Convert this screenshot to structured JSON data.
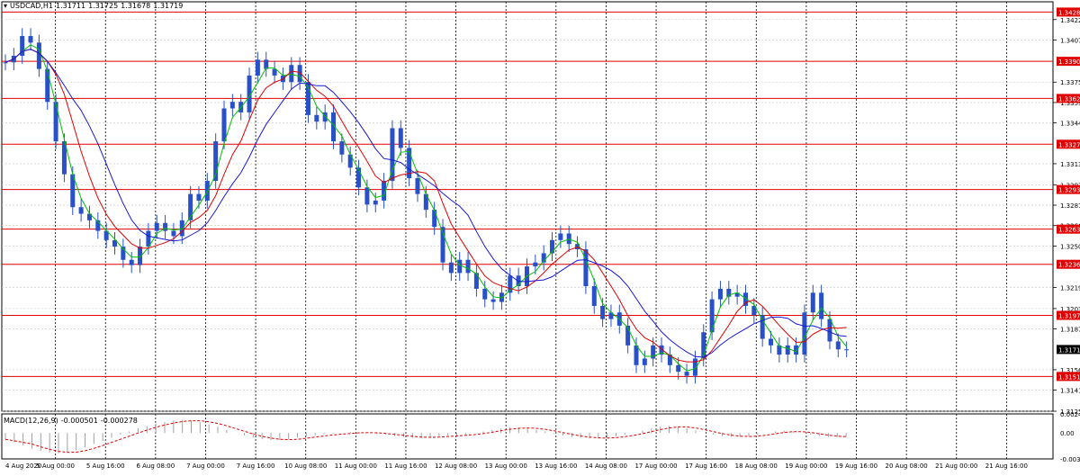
{
  "header": {
    "symbol": "USDCAD,H1",
    "open": "1.31711",
    "high": "1.31725",
    "low": "1.31678",
    "close": "1.31719"
  },
  "macd_header": {
    "name": "MACD(12,26,9)",
    "main": "-0.000501",
    "signal": "-0.000278"
  },
  "colors": {
    "candles": "#2850c8",
    "ma_fast": "#00c000",
    "ma_mid": "#e00000",
    "ma_slow": "#1818d8",
    "levels": "#e00000",
    "grid": "#c8c8c8",
    "price_tag_bg": "#e00000",
    "current_tag_bg": "#000000",
    "macd_signal": "#e00000",
    "macd_hist": "#a0a0a0"
  },
  "chart_data": [
    {
      "type": "line",
      "title": "USDCAD,H1",
      "xlabel": "",
      "ylabel": "",
      "ylim": [
        1.3125,
        1.3436
      ],
      "grid": true,
      "y_ticks": [
        "1.34225",
        "1.34070",
        "1.33750",
        "1.33595",
        "1.33440",
        "1.33130",
        "1.32970",
        "1.32815",
        "1.32660",
        "1.32505",
        "1.32190",
        "1.32030",
        "1.31875",
        "1.31565",
        "1.31410",
        "1.31250"
      ],
      "x_ticks": [
        "4 Aug 2020",
        "5 Aug 00:00",
        "5 Aug 16:00",
        "6 Aug 08:00",
        "7 Aug 00:00",
        "7 Aug 16:00",
        "10 Aug 08:00",
        "11 Aug 00:00",
        "11 Aug 16:00",
        "12 Aug 08:00",
        "13 Aug 00:00",
        "13 Aug 16:00",
        "14 Aug 08:00",
        "17 Aug 00:00",
        "17 Aug 16:00",
        "18 Aug 08:00",
        "19 Aug 00:00",
        "19 Aug 16:00",
        "20 Aug 08:00",
        "21 Aug 00:00",
        "21 Aug 16:00"
      ],
      "horizontal_levels": [
        "1.34282",
        "1.33908",
        "1.33626",
        "1.33278",
        "1.32934",
        "1.32633",
        "1.32366",
        "1.31978",
        "1.31514"
      ],
      "current_price": "1.31719",
      "series": [
        {
          "kind": "close",
          "values": [
            1.339,
            1.3395,
            1.341,
            1.3405,
            1.3385,
            1.336,
            1.333,
            1.3305,
            1.328,
            1.3275,
            1.327,
            1.3262,
            1.3255,
            1.325,
            1.324,
            1.3236,
            1.325,
            1.3262,
            1.3268,
            1.3262,
            1.3258,
            1.327,
            1.329,
            1.3285,
            1.33,
            1.333,
            1.3355,
            1.336,
            1.3352,
            1.338,
            1.3392,
            1.3385,
            1.338,
            1.3375,
            1.3388,
            1.3375,
            1.335,
            1.3345,
            1.3352,
            1.333,
            1.332,
            1.331,
            1.3295,
            1.3282,
            1.3285,
            1.33,
            1.334,
            1.3325,
            1.3302,
            1.329,
            1.3278,
            1.3265,
            1.3238,
            1.323,
            1.324,
            1.323,
            1.3218,
            1.321,
            1.3208,
            1.3215,
            1.3228,
            1.322,
            1.3235,
            1.3238,
            1.3245,
            1.3255,
            1.326,
            1.3252,
            1.3248,
            1.322,
            1.3205,
            1.3195,
            1.32,
            1.319,
            1.3175,
            1.316,
            1.3165,
            1.3175,
            1.3168,
            1.316,
            1.3155,
            1.3152,
            1.3165,
            1.3185,
            1.321,
            1.3218,
            1.3212,
            1.3215,
            1.3205,
            1.3198,
            1.318,
            1.3175,
            1.3168,
            1.3175,
            1.3168,
            1.32,
            1.3215,
            1.3195,
            1.3178,
            1.3172,
            1.3172
          ]
        },
        {
          "kind": "ma",
          "name": "",
          "period_hint": "fast",
          "values": []
        },
        {
          "kind": "ma",
          "name": "",
          "period_hint": "mid",
          "values": []
        },
        {
          "kind": "ma",
          "name": "",
          "period_hint": "slow",
          "values": []
        }
      ]
    },
    {
      "type": "bar",
      "title": "MACD(12,26,9)",
      "ylim": [
        -0.00332,
        0.00245
      ],
      "y_ticks": [
        "0.00245",
        "0.00",
        "-0.00332"
      ],
      "series": [
        {
          "kind": "histogram",
          "values": [
            -0.0008,
            -0.0012,
            -0.0016,
            -0.002,
            -0.0023,
            -0.0025,
            -0.0026,
            -0.0025,
            -0.0022,
            -0.0018,
            -0.0014,
            -0.001,
            -0.0006,
            -0.0002,
            0.0002,
            0.0006,
            0.0009,
            0.0012,
            0.0014,
            0.0016,
            0.0017,
            0.0016,
            0.0014,
            0.0011,
            0.0008,
            0.0004,
            0.0,
            -0.0003,
            -0.0006,
            -0.0008,
            -0.0009,
            -0.0009,
            -0.0008,
            -0.0006,
            -0.0004,
            -0.0003,
            -0.0002,
            -0.0001,
            0.0,
            0.0001,
            0.0001,
            0.0,
            -0.0001,
            -0.0002,
            -0.0004,
            -0.0005,
            -0.0006,
            -0.0006,
            -0.0005,
            -0.0004,
            -0.0003,
            -0.0003,
            -0.0002,
            0.0,
            0.0002,
            0.0004,
            0.0006,
            0.0007,
            0.0007,
            0.0006,
            0.0004,
            0.0002,
            -0.0001,
            -0.0003,
            -0.0005,
            -0.0006,
            -0.0007,
            -0.0007,
            -0.0006,
            -0.0004,
            -0.0002,
            0.0,
            0.0003,
            0.0006,
            0.0008,
            0.0009,
            0.0008,
            0.0006,
            0.0003,
            0.0,
            -0.0002,
            -0.0004,
            -0.0005,
            -0.0005,
            -0.0004,
            -0.0002,
            0.0,
            0.0002,
            0.0003,
            0.0002,
            0.0,
            -0.0002,
            -0.0004,
            -0.0005,
            -0.0005,
            -0.0005
          ]
        },
        {
          "kind": "signal",
          "values": []
        }
      ]
    }
  ]
}
